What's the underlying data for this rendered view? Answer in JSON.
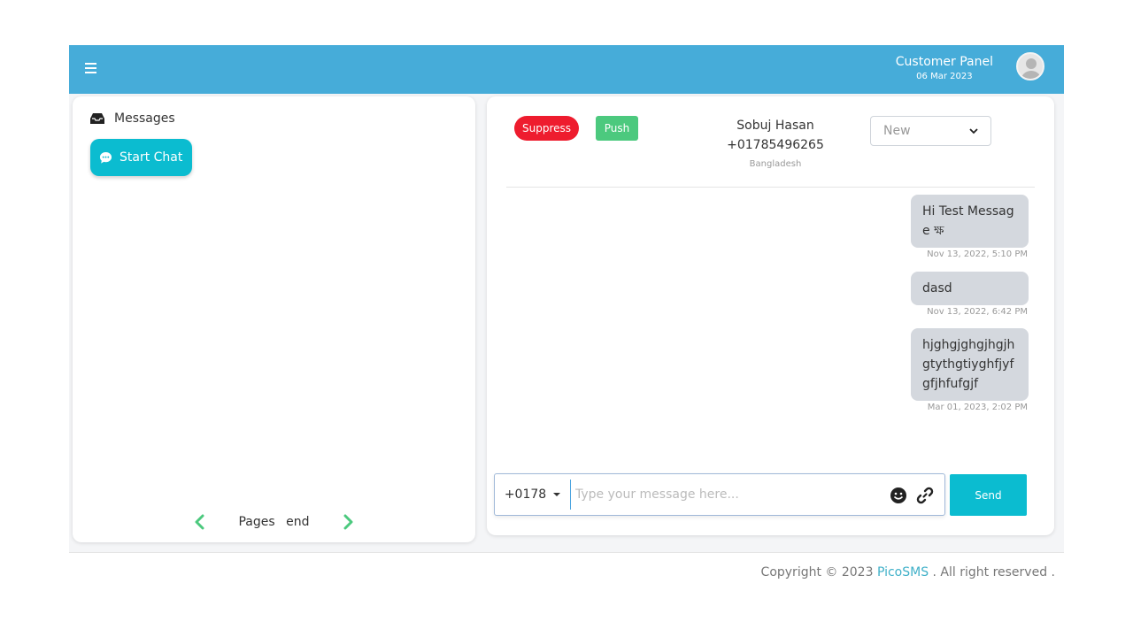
{
  "header": {
    "panel_title": "Customer Panel",
    "date": "06 Mar 2023"
  },
  "inbox": {
    "title": "Messages",
    "start_chat_label": "Start Chat",
    "pager": {
      "pages_label": "Pages",
      "page_value": "end"
    }
  },
  "conversation": {
    "suppress_label": "Suppress",
    "push_label": "Push",
    "contact": {
      "name": "Sobuj Hasan",
      "phone": "+01785496265",
      "country": "Bangladesh"
    },
    "status_selected": "New",
    "messages": [
      {
        "text": "Hi Test Message ক্ষ",
        "time": "Nov 13, 2022, 5:10 PM"
      },
      {
        "text": "dasd",
        "time": "Nov 13, 2022, 6:42 PM"
      },
      {
        "text": "hjghgjghgjhgjhgtythgtiyghfjyfgfjhfufgjf",
        "time": "Mar 01, 2023, 2:02 PM"
      }
    ]
  },
  "composer": {
    "sender_number": "+0178",
    "placeholder": "Type your message here...",
    "send_label": "Send"
  },
  "footer": {
    "prefix": "Copyright © 2023 ",
    "brand": "PicoSMS",
    "suffix": " . All right reserved ."
  },
  "colors": {
    "topbar": "#46acd9",
    "accent": "#0bbcd0",
    "suppress": "#ee1c2e",
    "push": "#4cc97e",
    "bubble": "#d4d8de",
    "pager_arrow": "#4cc97e"
  }
}
